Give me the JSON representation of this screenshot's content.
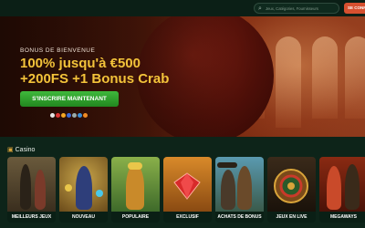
{
  "header": {
    "search_placeholder": "Jeux, Catégories, Fournisseurs",
    "signin_label": "SE CONN"
  },
  "hero": {
    "subtitle": "BONUS DE BIENVENUE",
    "headline_line1": "100% jusqu'à €500",
    "headline_line2": "+200FS +1 Bonus Crab",
    "cta_label": "S'INSCRIRE MAINTENANT",
    "colors": {
      "headline": "#f3c33a",
      "cta": "#2e9f2b"
    }
  },
  "casino": {
    "title": "Casino",
    "categories": [
      {
        "label": "MEILLEURS JEUX",
        "icon": "pirate-icon"
      },
      {
        "label": "NOUVEAU",
        "icon": "wizard-icon"
      },
      {
        "label": "POPULAIRE",
        "icon": "miner-icon"
      },
      {
        "label": "EXCLUSIF",
        "icon": "gem-icon"
      },
      {
        "label": "ACHATS DE BONUS",
        "icon": "cowboys-icon"
      },
      {
        "label": "JEUX EN LIVE",
        "icon": "roulette-icon"
      },
      {
        "label": "MEGAWAYS",
        "icon": "warriors-icon"
      }
    ]
  }
}
